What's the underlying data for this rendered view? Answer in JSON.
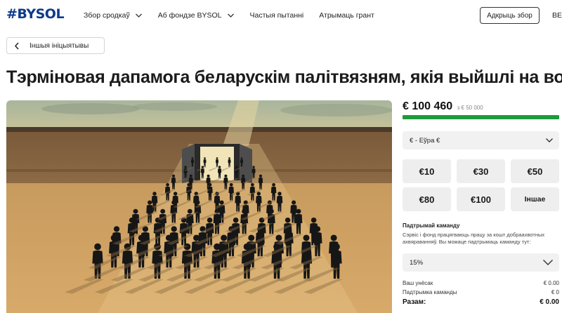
{
  "header": {
    "logo": "#BYSOL",
    "nav": [
      {
        "label": "Збор сродкаў",
        "has_dropdown": true
      },
      {
        "label": "Аб фондзе BYSOL",
        "has_dropdown": true
      },
      {
        "label": "Частыя пытанні",
        "has_dropdown": false
      },
      {
        "label": "Атрымаць грант",
        "has_dropdown": false
      }
    ],
    "open_button": "Адкрыць збор",
    "language": "BE"
  },
  "back_button": "Іншыя ініцыятывы",
  "page_title": "Тэрміновая дапамога беларускім палітвязням, якія выйшлі на волю",
  "campaign": {
    "raised": "€ 100 460",
    "goal": "з € 50 000",
    "progress": 1.0,
    "currency_select": "€ - Еўра €",
    "amount_options": [
      "€10",
      "€30",
      "€50",
      "€80",
      "€100",
      "Іншае"
    ],
    "support": {
      "title": "Падтрымай каманду",
      "description": "Сэрвіс і фонд працягваюць працу за кошт добраахвотных ахвяраванняў. Вы можаце падтрымаць каманду тут:",
      "percent_select": "15%"
    },
    "summary": {
      "your_contribution_label": "Ваш унёсак",
      "your_contribution_value": "€ 0.00",
      "team_support_label": "Падтрымка каманды",
      "team_support_value": "€ 0",
      "total_label": "Разам:",
      "total_value": "€ 0.00"
    }
  },
  "colors": {
    "brand": "#0e3a8c",
    "progress": "#1f9b3b",
    "button_bg": "#eeeeee"
  },
  "icons": [
    "chevron-down-icon",
    "chevron-left-icon"
  ]
}
